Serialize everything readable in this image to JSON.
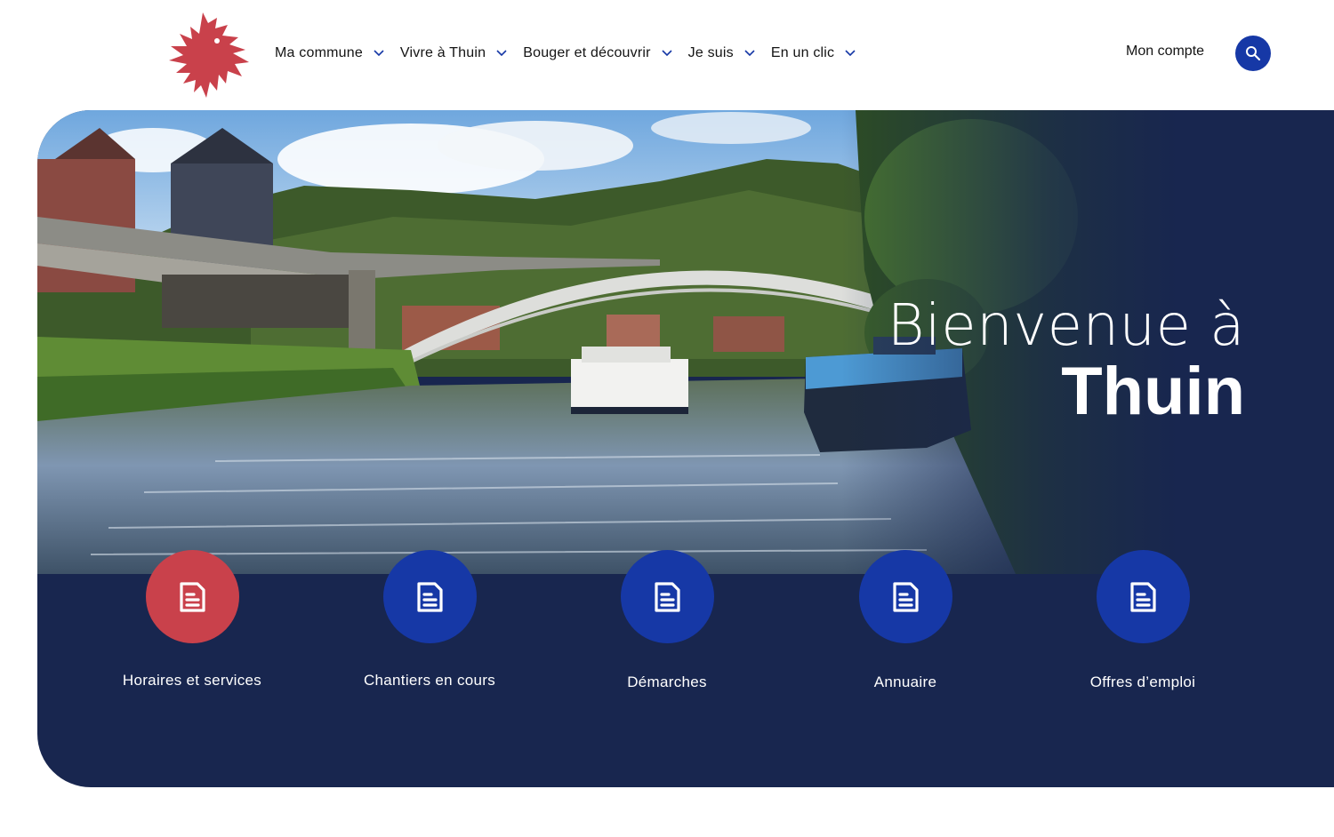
{
  "header": {
    "logo_icon": "lion-coat-of-arms-icon",
    "nav": [
      {
        "label": "Ma commune"
      },
      {
        "label": "Vivre à Thuin"
      },
      {
        "label": "Bouger et découvrir"
      },
      {
        "label": "Je suis"
      },
      {
        "label": "En un clic"
      }
    ],
    "account_label": "Mon compte",
    "search_icon": "search-icon"
  },
  "hero": {
    "welcome_line1": "Bienvenue à",
    "welcome_line2": "Thuin",
    "photo": "river-boats-bridge-photo"
  },
  "quick_links": [
    {
      "label": "Horaires et services",
      "icon": "document-icon",
      "color": "#c9414b"
    },
    {
      "label": "Chantiers en cours",
      "icon": "document-icon",
      "color": "#1638a6"
    },
    {
      "label": "Démarches",
      "icon": "document-icon",
      "color": "#1638a6"
    },
    {
      "label": "Annuaire",
      "icon": "document-icon",
      "color": "#1638a6"
    },
    {
      "label": "Offres d’emploi",
      "icon": "document-icon",
      "color": "#1638a6"
    }
  ],
  "colors": {
    "navy": "#18264f",
    "accent_blue": "#1638a6",
    "accent_red": "#c9414b"
  }
}
